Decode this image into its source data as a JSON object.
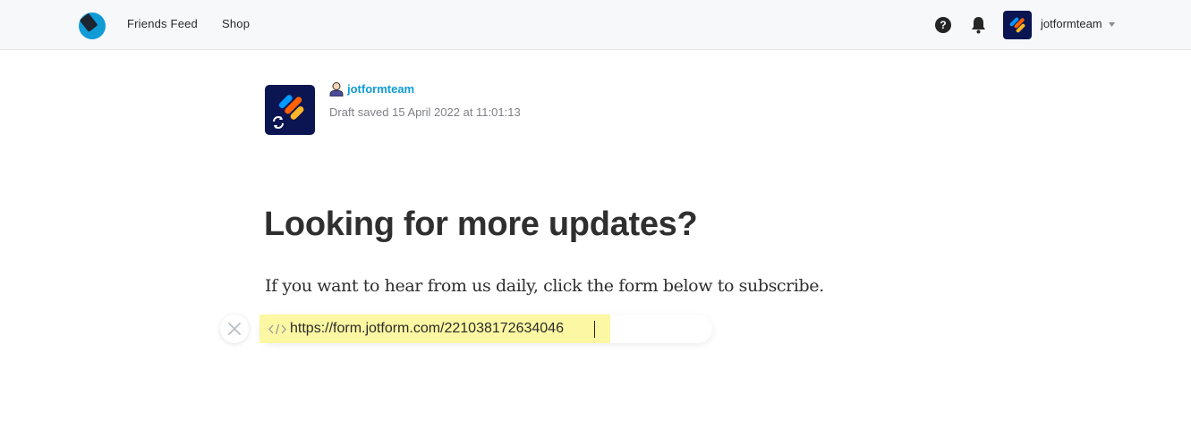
{
  "nav": {
    "friends_feed": "Friends Feed",
    "shop": "Shop",
    "help_glyph": "?",
    "username": "jotformteam"
  },
  "author": {
    "name": "jotformteam",
    "draft_status": "Draft saved 15 April 2022 at 11:01:13"
  },
  "post": {
    "title": "Looking for more updates?",
    "paragraph": "If you want to hear from us daily, click the form below to subscribe."
  },
  "embed": {
    "value": "https://form.jotform.com/221038172634046",
    "close_glyph": "×"
  },
  "colors": {
    "brand_blue": "#0f9bd6",
    "avatar_bg": "#0a1551",
    "jotform_orange": "#ff6100",
    "jotform_yellow": "#ffb629",
    "jotform_blue": "#0099ff",
    "highlight_yellow": "#fbf7a2"
  },
  "icons": {
    "logo": "medium-style-logo-icon",
    "help": "question-circle-icon",
    "notifications": "bell-icon",
    "dropdown": "caret-down-icon",
    "author": "user-icon",
    "refresh": "refresh-icon",
    "close": "close-icon",
    "embed": "code-icon"
  }
}
